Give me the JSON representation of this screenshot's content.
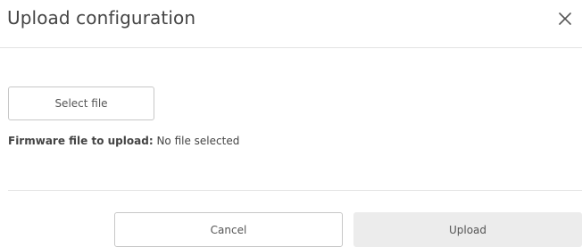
{
  "dialog": {
    "title": "Upload configuration",
    "close_icon": "close-icon",
    "select_file_label": "Select file",
    "file_status_label": "Firmware file to upload",
    "file_status_separator": ":",
    "file_status_value": "No file selected",
    "cancel_label": "Cancel",
    "upload_label": "Upload"
  },
  "colors": {
    "divider": "#e3e3e3",
    "button_border": "#c7c7c7",
    "upload_disabled_bg": "#ececec"
  }
}
